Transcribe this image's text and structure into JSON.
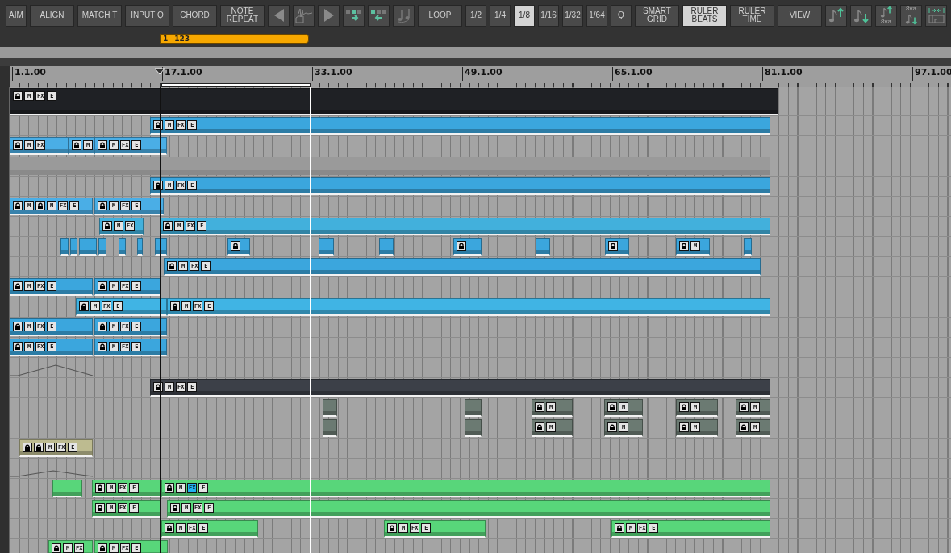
{
  "toolbar": [
    {
      "kind": "short",
      "label": "AIM",
      "selected": false
    },
    {
      "kind": "text",
      "label": "ALIGN",
      "selected": false
    },
    {
      "kind": "text",
      "label": "MATCH T",
      "selected": false
    },
    {
      "kind": "text",
      "label": "INPUT Q",
      "selected": false
    },
    {
      "kind": "text",
      "label": "CHORD",
      "selected": false
    },
    {
      "kind": "text",
      "label": "NOTE REPEAT",
      "selected": false
    },
    {
      "kind": "icon",
      "selected": false
    },
    {
      "kind": "icon",
      "selected": false
    },
    {
      "kind": "icon",
      "selected": false
    },
    {
      "kind": "icon",
      "selected": false
    },
    {
      "kind": "icon",
      "selected": false
    },
    {
      "kind": "icon",
      "selected": false
    },
    {
      "kind": "text",
      "label": "LOOP",
      "selected": false
    },
    {
      "kind": "short",
      "label": "1/2",
      "selected": false
    },
    {
      "kind": "short",
      "label": "1/4",
      "selected": false
    },
    {
      "kind": "short",
      "label": "1/8",
      "selected": true
    },
    {
      "kind": "short",
      "label": "1/16",
      "selected": false
    },
    {
      "kind": "short",
      "label": "1/32",
      "selected": false
    },
    {
      "kind": "short",
      "label": "1/64",
      "selected": false
    },
    {
      "kind": "short",
      "label": "Q",
      "selected": false
    },
    {
      "kind": "text",
      "label": "SMART GRID",
      "selected": false
    },
    {
      "kind": "text",
      "label": "RULER BEATS",
      "selected": true
    },
    {
      "kind": "text",
      "label": "RULER TIME",
      "selected": false
    },
    {
      "kind": "text",
      "label": "VIEW",
      "selected": false
    },
    {
      "kind": "icon",
      "selected": false
    },
    {
      "kind": "icon",
      "selected": false
    },
    {
      "kind": "icon",
      "text": "8va",
      "selected": false
    },
    {
      "kind": "icon",
      "text": "8va",
      "selected": false
    },
    {
      "kind": "icon",
      "selected": false
    }
  ],
  "loop": {
    "bar": "1",
    "length": "123"
  },
  "ruler": [
    "1.1.00",
    "17.1.00",
    "33.1.00",
    "49.1.00",
    "65.1.00",
    "81.1.00",
    "97.1.00"
  ],
  "tracks": [
    {
      "kind": "clips",
      "clips": [
        {
          "color": "#1f2125",
          "controls": [
            {
              "kind": "lock"
            },
            {
              "kind": "label",
              "text": "M",
              "on": false
            },
            {
              "kind": "label",
              "text": "FX",
              "on": false
            },
            {
              "kind": "label",
              "text": "E",
              "on": false
            }
          ]
        }
      ]
    },
    {
      "kind": "clips",
      "clips": [
        {
          "color": "#3ba6dd",
          "controls": [
            {
              "kind": "lock"
            },
            {
              "kind": "label",
              "text": "M",
              "on": false
            },
            {
              "kind": "label",
              "text": "FX",
              "on": false
            },
            {
              "kind": "label",
              "text": "E",
              "on": false
            }
          ]
        }
      ]
    },
    {
      "kind": "clips",
      "clips": [
        {
          "color": "#4aaee6",
          "controls": [
            {
              "kind": "lock"
            },
            {
              "kind": "label",
              "text": "M",
              "on": false
            },
            {
              "kind": "label",
              "text": "FX",
              "on": false
            }
          ]
        },
        {
          "color": "#4aaee6",
          "controls": [
            {
              "kind": "lock"
            },
            {
              "kind": "label",
              "text": "M",
              "on": false
            }
          ]
        },
        {
          "color": "#4aaee6",
          "controls": [
            {
              "kind": "lock"
            },
            {
              "kind": "label",
              "text": "M",
              "on": false
            },
            {
              "kind": "label",
              "text": "FX",
              "on": false
            },
            {
              "kind": "label",
              "text": "E",
              "on": false
            }
          ]
        }
      ]
    },
    {
      "kind": "clips",
      "clips": [
        {
          "color": "#9a9a9a"
        }
      ]
    },
    {
      "kind": "clips",
      "clips": [
        {
          "color": "#3ba6dd",
          "controls": [
            {
              "kind": "lock"
            },
            {
              "kind": "label",
              "text": "M",
              "on": false
            },
            {
              "kind": "label",
              "text": "FX",
              "on": false
            },
            {
              "kind": "label",
              "text": "E",
              "on": false
            }
          ]
        }
      ]
    },
    {
      "kind": "clips",
      "clips": [
        {
          "color": "#4aaee6",
          "controls": [
            {
              "kind": "lock"
            },
            {
              "kind": "label",
              "text": "M",
              "on": false
            },
            {
              "kind": "lock"
            },
            {
              "kind": "label",
              "text": "M",
              "on": false
            },
            {
              "kind": "label",
              "text": "FX",
              "on": false
            },
            {
              "kind": "label",
              "text": "E",
              "on": false
            }
          ]
        },
        {
          "color": "#4aaee6",
          "controls": [
            {
              "kind": "lock"
            },
            {
              "kind": "label",
              "text": "M",
              "on": false
            },
            {
              "kind": "label",
              "text": "FX",
              "on": false
            },
            {
              "kind": "label",
              "text": "E",
              "on": false
            }
          ]
        }
      ]
    },
    {
      "kind": "clips",
      "clips": [
        {
          "color": "#42b0dc",
          "controls": [
            {
              "kind": "lock"
            },
            {
              "kind": "label",
              "text": "M",
              "on": false
            },
            {
              "kind": "label",
              "text": "FX",
              "on": false
            }
          ]
        },
        {
          "color": "#42b0dc",
          "controls": [
            {
              "kind": "lock"
            },
            {
              "kind": "label",
              "text": "M",
              "on": false
            },
            {
              "kind": "label",
              "text": "FX",
              "on": false
            },
            {
              "kind": "label",
              "text": "E",
              "on": false
            }
          ]
        }
      ]
    },
    {
      "kind": "clips",
      "clips": [
        {
          "color": "#3ba6dd"
        },
        {
          "color": "#3ba6dd"
        },
        {
          "color": "#3ba6dd"
        },
        {
          "color": "#3ba6dd"
        },
        {
          "color": "#3ba6dd"
        },
        {
          "color": "#3ba6dd"
        },
        {
          "color": "#3ba6dd"
        },
        {
          "color": "#3ba6dd",
          "controls": [
            {
              "kind": "lock"
            }
          ]
        },
        {
          "color": "#3ba6dd"
        },
        {
          "color": "#3ba6dd"
        },
        {
          "color": "#3ba6dd",
          "controls": [
            {
              "kind": "lock"
            }
          ]
        },
        {
          "color": "#3ba6dd"
        },
        {
          "color": "#3ba6dd",
          "controls": [
            {
              "kind": "lock"
            }
          ]
        },
        {
          "color": "#3ba6dd",
          "controls": [
            {
              "kind": "lock"
            },
            {
              "kind": "label",
              "text": "M",
              "on": false
            }
          ]
        },
        {
          "color": "#3ba6dd"
        }
      ]
    },
    {
      "kind": "clips",
      "clips": [
        {
          "color": "#3ba6dd",
          "controls": [
            {
              "kind": "lock"
            },
            {
              "kind": "label",
              "text": "M",
              "on": false
            },
            {
              "kind": "label",
              "text": "FX",
              "on": false
            },
            {
              "kind": "label",
              "text": "E",
              "on": false
            }
          ]
        }
      ]
    },
    {
      "kind": "clips",
      "clips": [
        {
          "color": "#3ba6dd",
          "controls": [
            {
              "kind": "lock"
            },
            {
              "kind": "label",
              "text": "M",
              "on": false
            },
            {
              "kind": "label",
              "text": "FX",
              "on": false
            },
            {
              "kind": "label",
              "text": "E",
              "on": false
            }
          ]
        },
        {
          "color": "#3ba6dd",
          "controls": [
            {
              "kind": "lock"
            },
            {
              "kind": "label",
              "text": "M",
              "on": false
            },
            {
              "kind": "label",
              "text": "FX",
              "on": false
            },
            {
              "kind": "label",
              "text": "E",
              "on": false
            }
          ]
        }
      ]
    },
    {
      "kind": "clips",
      "clips": [
        {
          "color": "#40b4e4",
          "controls": [
            {
              "kind": "lock"
            },
            {
              "kind": "label",
              "text": "M",
              "on": false
            },
            {
              "kind": "label",
              "text": "FX",
              "on": false
            },
            {
              "kind": "label",
              "text": "E",
              "on": false
            }
          ]
        },
        {
          "color": "#40b4e4",
          "controls": [
            {
              "kind": "lock"
            },
            {
              "kind": "label",
              "text": "M",
              "on": false
            },
            {
              "kind": "label",
              "text": "FX",
              "on": false
            },
            {
              "kind": "label",
              "text": "E",
              "on": false
            }
          ]
        }
      ]
    },
    {
      "kind": "clips",
      "clips": [
        {
          "color": "#3ba6dd",
          "controls": [
            {
              "kind": "lock"
            },
            {
              "kind": "label",
              "text": "M",
              "on": false
            },
            {
              "kind": "label",
              "text": "FX",
              "on": false
            },
            {
              "kind": "label",
              "text": "E",
              "on": false
            }
          ]
        },
        {
          "color": "#3ba6dd",
          "controls": [
            {
              "kind": "lock"
            },
            {
              "kind": "label",
              "text": "M",
              "on": false
            },
            {
              "kind": "label",
              "text": "FX",
              "on": false
            },
            {
              "kind": "label",
              "text": "E",
              "on": false
            }
          ]
        }
      ]
    },
    {
      "kind": "clips",
      "clips": [
        {
          "color": "#3ba6dd",
          "controls": [
            {
              "kind": "lock"
            },
            {
              "kind": "label",
              "text": "M",
              "on": false
            },
            {
              "kind": "label",
              "text": "FX",
              "on": false
            },
            {
              "kind": "label",
              "text": "E",
              "on": false
            }
          ]
        },
        {
          "color": "#3ba6dd",
          "controls": [
            {
              "kind": "lock"
            },
            {
              "kind": "label",
              "text": "M",
              "on": false
            },
            {
              "kind": "label",
              "text": "FX",
              "on": false
            },
            {
              "kind": "label",
              "text": "E",
              "on": false
            }
          ]
        }
      ]
    },
    {
      "kind": "automation"
    },
    {
      "kind": "clips",
      "clips": [
        {
          "color": "#3c4048",
          "controls": [
            {
              "kind": "lock"
            },
            {
              "kind": "label",
              "text": "M",
              "on": false
            },
            {
              "kind": "label",
              "text": "FX",
              "on": false
            },
            {
              "kind": "label",
              "text": "E",
              "on": false
            }
          ]
        }
      ]
    },
    {
      "kind": "clips",
      "clips": [
        {
          "color": "#6b7a72"
        },
        {
          "color": "#6b7a72"
        },
        {
          "color": "#6b7a72",
          "controls": [
            {
              "kind": "lock"
            },
            {
              "kind": "label",
              "text": "M",
              "on": false
            }
          ]
        },
        {
          "color": "#6b7a72",
          "controls": [
            {
              "kind": "lock"
            },
            {
              "kind": "label",
              "text": "M",
              "on": false
            }
          ]
        },
        {
          "color": "#6b7a72",
          "controls": [
            {
              "kind": "lock"
            },
            {
              "kind": "label",
              "text": "M",
              "on": false
            }
          ]
        },
        {
          "color": "#6b7a72",
          "controls": [
            {
              "kind": "lock"
            },
            {
              "kind": "label",
              "text": "M",
              "on": false
            }
          ]
        }
      ]
    },
    {
      "kind": "clips",
      "clips": [
        {
          "color": "#6b7a72"
        },
        {
          "color": "#6b7a72"
        },
        {
          "color": "#6b7a72",
          "controls": [
            {
              "kind": "lock"
            },
            {
              "kind": "label",
              "text": "M",
              "on": false
            }
          ]
        },
        {
          "color": "#6b7a72",
          "controls": [
            {
              "kind": "lock"
            },
            {
              "kind": "label",
              "text": "M",
              "on": false
            }
          ]
        },
        {
          "color": "#6b7a72",
          "controls": [
            {
              "kind": "lock"
            },
            {
              "kind": "label",
              "text": "M",
              "on": false
            }
          ]
        },
        {
          "color": "#6b7a72",
          "controls": [
            {
              "kind": "lock"
            },
            {
              "kind": "label",
              "text": "M",
              "on": false
            }
          ]
        }
      ]
    },
    {
      "kind": "clips",
      "clips": [
        {
          "color": "#bdbb90",
          "controls": [
            {
              "kind": "lock"
            },
            {
              "kind": "lock"
            },
            {
              "kind": "label",
              "text": "M",
              "on": false
            },
            {
              "kind": "label",
              "text": "FX",
              "on": false
            },
            {
              "kind": "label",
              "text": "E",
              "on": false
            }
          ]
        }
      ]
    },
    {
      "kind": "automation"
    },
    {
      "kind": "clips",
      "clips": [
        {
          "color": "#58d67a"
        },
        {
          "color": "#58d67a",
          "controls": [
            {
              "kind": "lock"
            },
            {
              "kind": "label",
              "text": "M",
              "on": false
            },
            {
              "kind": "label",
              "text": "FX",
              "on": false
            },
            {
              "kind": "label",
              "text": "E",
              "on": false
            }
          ]
        },
        {
          "color": "#58d67a",
          "controls": [
            {
              "kind": "lock"
            },
            {
              "kind": "label",
              "text": "M",
              "on": false
            },
            {
              "kind": "label",
              "text": "FX",
              "on": true
            },
            {
              "kind": "label",
              "text": "E",
              "on": false
            }
          ]
        }
      ]
    },
    {
      "kind": "clips",
      "clips": [
        {
          "color": "#58d67a",
          "controls": [
            {
              "kind": "lock"
            },
            {
              "kind": "label",
              "text": "M",
              "on": false
            },
            {
              "kind": "label",
              "text": "FX",
              "on": false
            },
            {
              "kind": "label",
              "text": "E",
              "on": false
            }
          ]
        },
        {
          "color": "#58d67a",
          "controls": [
            {
              "kind": "lock"
            },
            {
              "kind": "label",
              "text": "M",
              "on": false
            },
            {
              "kind": "label",
              "text": "FX",
              "on": false
            },
            {
              "kind": "label",
              "text": "E",
              "on": false
            }
          ]
        }
      ]
    },
    {
      "kind": "clips",
      "clips": [
        {
          "color": "#58d67a",
          "controls": [
            {
              "kind": "lock"
            },
            {
              "kind": "label",
              "text": "M",
              "on": false
            },
            {
              "kind": "label",
              "text": "FX",
              "on": false
            },
            {
              "kind": "label",
              "text": "E",
              "on": false
            }
          ]
        },
        {
          "color": "#58d67a",
          "controls": [
            {
              "kind": "lock"
            },
            {
              "kind": "label",
              "text": "M",
              "on": false
            },
            {
              "kind": "label",
              "text": "FX",
              "on": false
            },
            {
              "kind": "label",
              "text": "E",
              "on": false
            }
          ]
        },
        {
          "color": "#58d67a",
          "controls": [
            {
              "kind": "lock"
            },
            {
              "kind": "label",
              "text": "M",
              "on": false
            },
            {
              "kind": "label",
              "text": "FX",
              "on": false
            },
            {
              "kind": "label",
              "text": "E",
              "on": false
            }
          ]
        }
      ]
    },
    {
      "kind": "clips",
      "clips": [
        {
          "color": "#58d67a",
          "controls": [
            {
              "kind": "lock"
            },
            {
              "kind": "label",
              "text": "M",
              "on": false
            },
            {
              "kind": "label",
              "text": "FX",
              "on": false
            }
          ]
        },
        {
          "color": "#58d67a",
          "controls": [
            {
              "kind": "lock"
            },
            {
              "kind": "label",
              "text": "M",
              "on": false
            },
            {
              "kind": "label",
              "text": "FX",
              "on": false
            },
            {
              "kind": "label",
              "text": "E",
              "on": false
            }
          ]
        }
      ]
    }
  ]
}
